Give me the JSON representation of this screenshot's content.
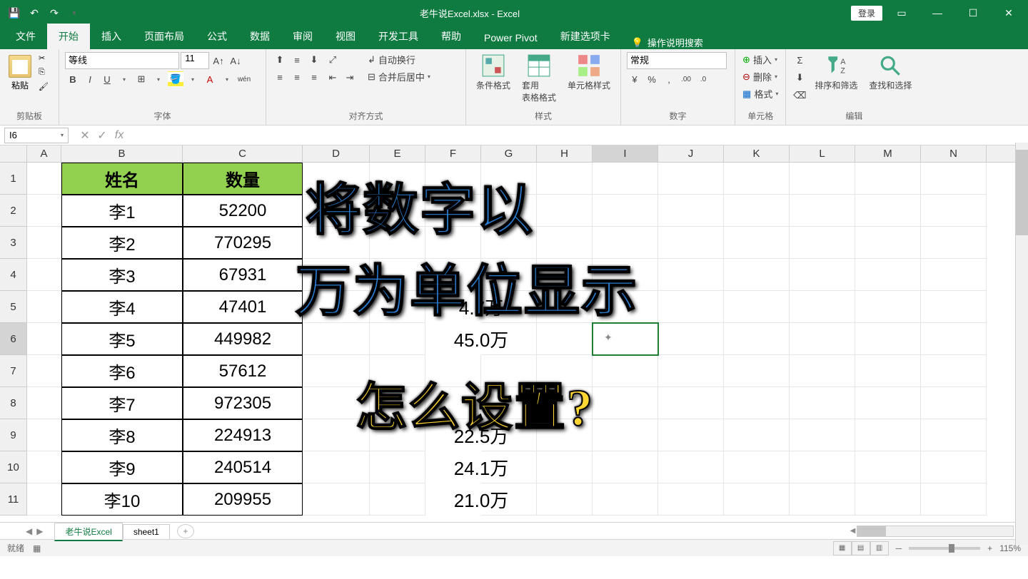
{
  "title": "老牛说Excel.xlsx - Excel",
  "login": "登录",
  "tabs": {
    "file": "文件",
    "home": "开始",
    "insert": "插入",
    "pagelayout": "页面布局",
    "formulas": "公式",
    "data": "数据",
    "review": "审阅",
    "view": "视图",
    "developer": "开发工具",
    "help": "帮助",
    "powerpivot": "Power Pivot",
    "newtab": "新建选项卡",
    "tellme": "操作说明搜索"
  },
  "ribbon": {
    "clipboard": "剪贴板",
    "paste": "粘贴",
    "font": "字体",
    "fontName": "等线",
    "fontSize": "11",
    "alignment": "对齐方式",
    "wrapText": "自动换行",
    "mergeCenter": "合并后居中",
    "number": "数字",
    "numberFormat": "常规",
    "styles": "样式",
    "condFormat": "条件格式",
    "tableFormat": "套用\n表格格式",
    "cellStyles": "单元格样式",
    "cells": "单元格",
    "insert": "插入",
    "delete": "删除",
    "format": "格式",
    "editing": "编辑",
    "sortFilter": "排序和筛选",
    "findSelect": "查找和选择"
  },
  "nameBox": "I6",
  "columns": [
    "A",
    "B",
    "C",
    "D",
    "E",
    "F",
    "G",
    "H",
    "I",
    "J",
    "K",
    "L",
    "M",
    "N"
  ],
  "tableHeaders": {
    "name": "姓名",
    "qty": "数量"
  },
  "tableData": [
    {
      "name": "李1",
      "qty": "52200"
    },
    {
      "name": "李2",
      "qty": "770295"
    },
    {
      "name": "李3",
      "qty": "67931"
    },
    {
      "name": "李4",
      "qty": "47401"
    },
    {
      "name": "李5",
      "qty": "449982"
    },
    {
      "name": "李6",
      "qty": "57612"
    },
    {
      "name": "李7",
      "qty": "972305"
    },
    {
      "name": "李8",
      "qty": "224913"
    },
    {
      "name": "李9",
      "qty": "240514"
    },
    {
      "name": "李10",
      "qty": "209955"
    }
  ],
  "wanValues": [
    "",
    "",
    "",
    "4.7万",
    "45.0万",
    "",
    "",
    "22.5万",
    "24.1万",
    "21.0万"
  ],
  "overlays": {
    "l1": "将数字以",
    "l2": "万为单位显示",
    "l3": "怎么设置?"
  },
  "sheetTabs": {
    "active": "老牛说Excel",
    "other": "sheet1"
  },
  "status": {
    "ready": "就绪",
    "zoom": "115%"
  }
}
